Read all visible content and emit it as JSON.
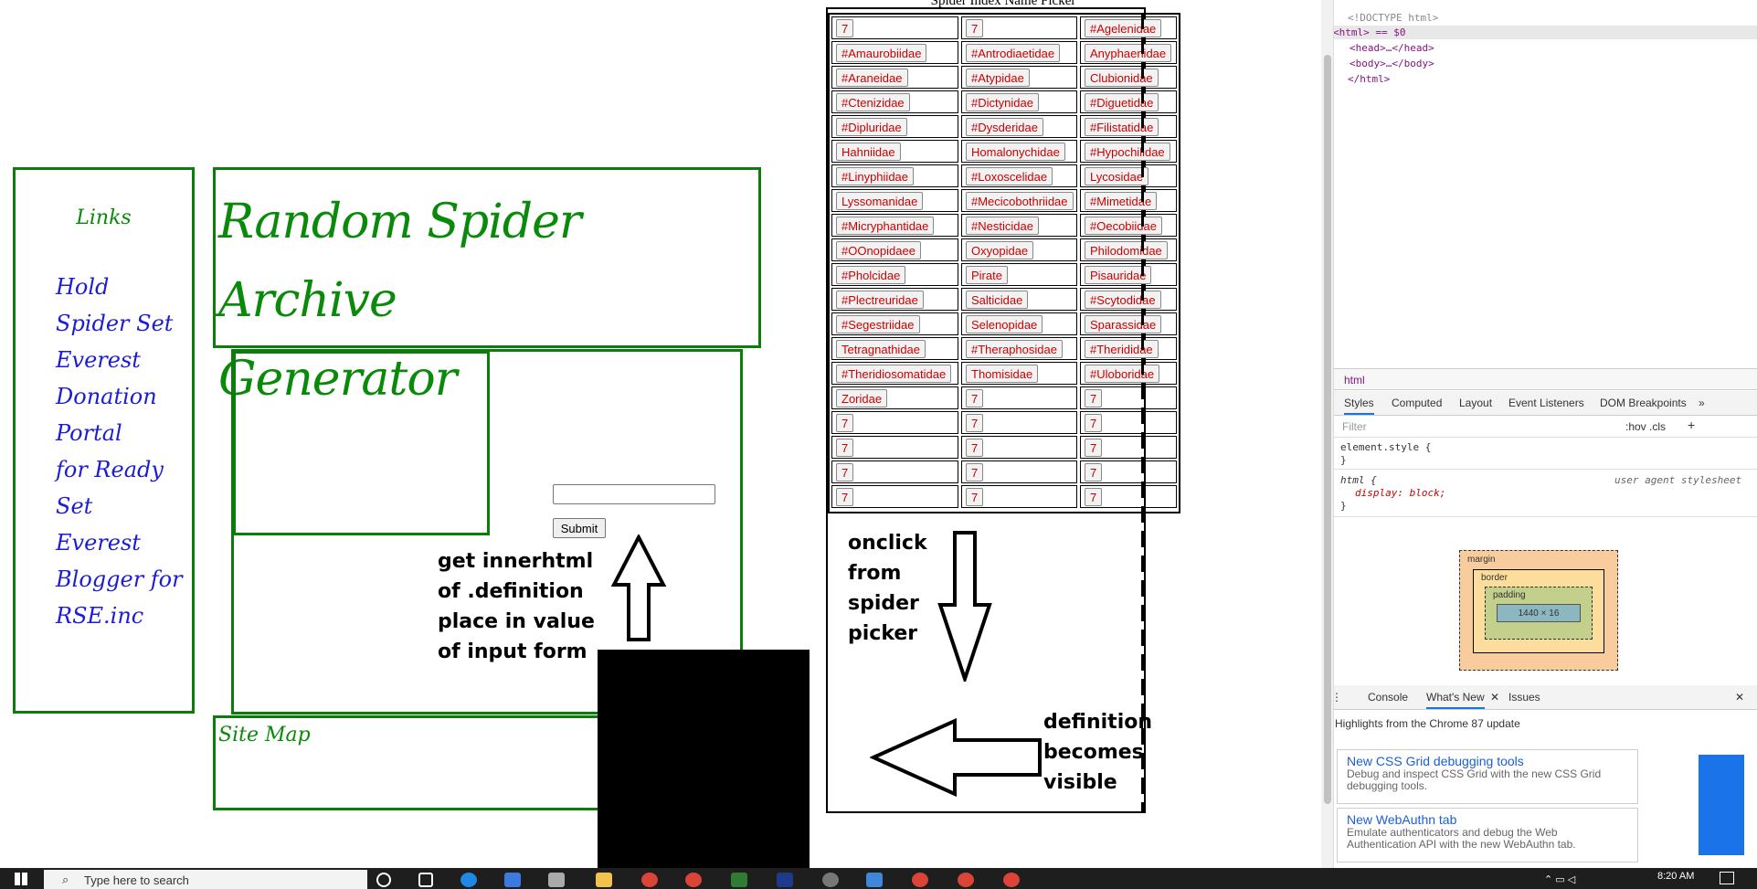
{
  "sidebar": {
    "title": "Links",
    "links": [
      "Hold",
      "Spider Set Everest",
      "Donation Portal",
      "for Ready Set",
      "Everest",
      "Blogger for",
      "RSE.inc"
    ]
  },
  "header": {
    "title_line1": "Random Spider Archive",
    "title_line2": "Generator"
  },
  "form": {
    "submit_label": "Submit",
    "input_value": ""
  },
  "notes": {
    "get_innerhtml": [
      "get innerhtml",
      "of .definition",
      "place in value",
      "of input form"
    ],
    "onclick": [
      "onclick",
      "from",
      "spider",
      "picker"
    ],
    "definition": [
      "definition",
      "becomes",
      "visible"
    ]
  },
  "footer": {
    "sitemap_label": "Site Map"
  },
  "picker": {
    "title": "Spider Index Name Picker",
    "rows": [
      [
        "7",
        "7",
        "#Agelenidae"
      ],
      [
        "#Amaurobiidae",
        "#Antrodiaetidae",
        "Anyphaenidae"
      ],
      [
        "#Araneidae",
        "#Atypidae",
        "Clubionidae"
      ],
      [
        "#Ctenizidae",
        "#Dictynidae",
        "#Diguetidae"
      ],
      [
        "#Dipluridae",
        "#Dysderidae",
        "#Filistatidae"
      ],
      [
        "Hahniidae",
        "Homalonychidae",
        "#Hypochilidae"
      ],
      [
        "#Linyphiidae",
        "#Loxoscelidae",
        "Lycosidae"
      ],
      [
        "Lyssomanidae",
        "#Mecicobothriidae",
        "#Mimetidae"
      ],
      [
        "#Micryphantidae",
        "#Nesticidae",
        "#Oecobiidae"
      ],
      [
        "#OOnopidaee",
        "Oxyopidae",
        "Philodomidae"
      ],
      [
        "#Pholcidae",
        "Pirate",
        "Pisauridae"
      ],
      [
        "#Plectreuridae",
        "Salticidae",
        "#Scytodidae"
      ],
      [
        "#Segestriidae",
        "Selenopidae",
        "Sparassidae"
      ],
      [
        "Tetragnathidae",
        "#Theraphosidae",
        "#Therididae"
      ],
      [
        "#Theridiosomatidae",
        "Thomisidae",
        "#Uloboridae"
      ],
      [
        "Zoridae",
        "7",
        "7"
      ],
      [
        "7",
        "7",
        "7"
      ],
      [
        "7",
        "7",
        "7"
      ],
      [
        "7",
        "7",
        "7"
      ],
      [
        "7",
        "7",
        "7"
      ]
    ]
  },
  "devtools": {
    "dom": [
      "<!DOCTYPE html>",
      "<html> == $0",
      "<head>…</head>",
      "<body>…</body>",
      "</html>"
    ],
    "breadcrumb": "html",
    "style_tabs": [
      "Styles",
      "Computed",
      "Layout",
      "Event Listeners",
      "DOM Breakpoints"
    ],
    "filter_placeholder": "Filter",
    "filter_tools": ":hov .cls",
    "element_style": "element.style {",
    "html_rule": "html {",
    "html_rule_source": "user agent stylesheet",
    "html_decl": "display: block;",
    "box_labels": {
      "margin": "margin",
      "border": "border",
      "padding": "padding",
      "size": "1440 × 16"
    },
    "drawer_tabs": [
      "Console",
      "What's New",
      "Issues"
    ],
    "drawer_heading": "Highlights from the Chrome 87 update",
    "cards": [
      {
        "title": "New CSS Grid debugging tools",
        "desc": "Debug and inspect CSS Grid with the new CSS Grid debugging tools."
      },
      {
        "title": "New WebAuthn tab",
        "desc": "Emulate authenticators and debug the Web Authentication API with the new WebAuthn tab."
      }
    ]
  },
  "taskbar": {
    "search_placeholder": "Type here to search",
    "time": "8:20 AM"
  }
}
